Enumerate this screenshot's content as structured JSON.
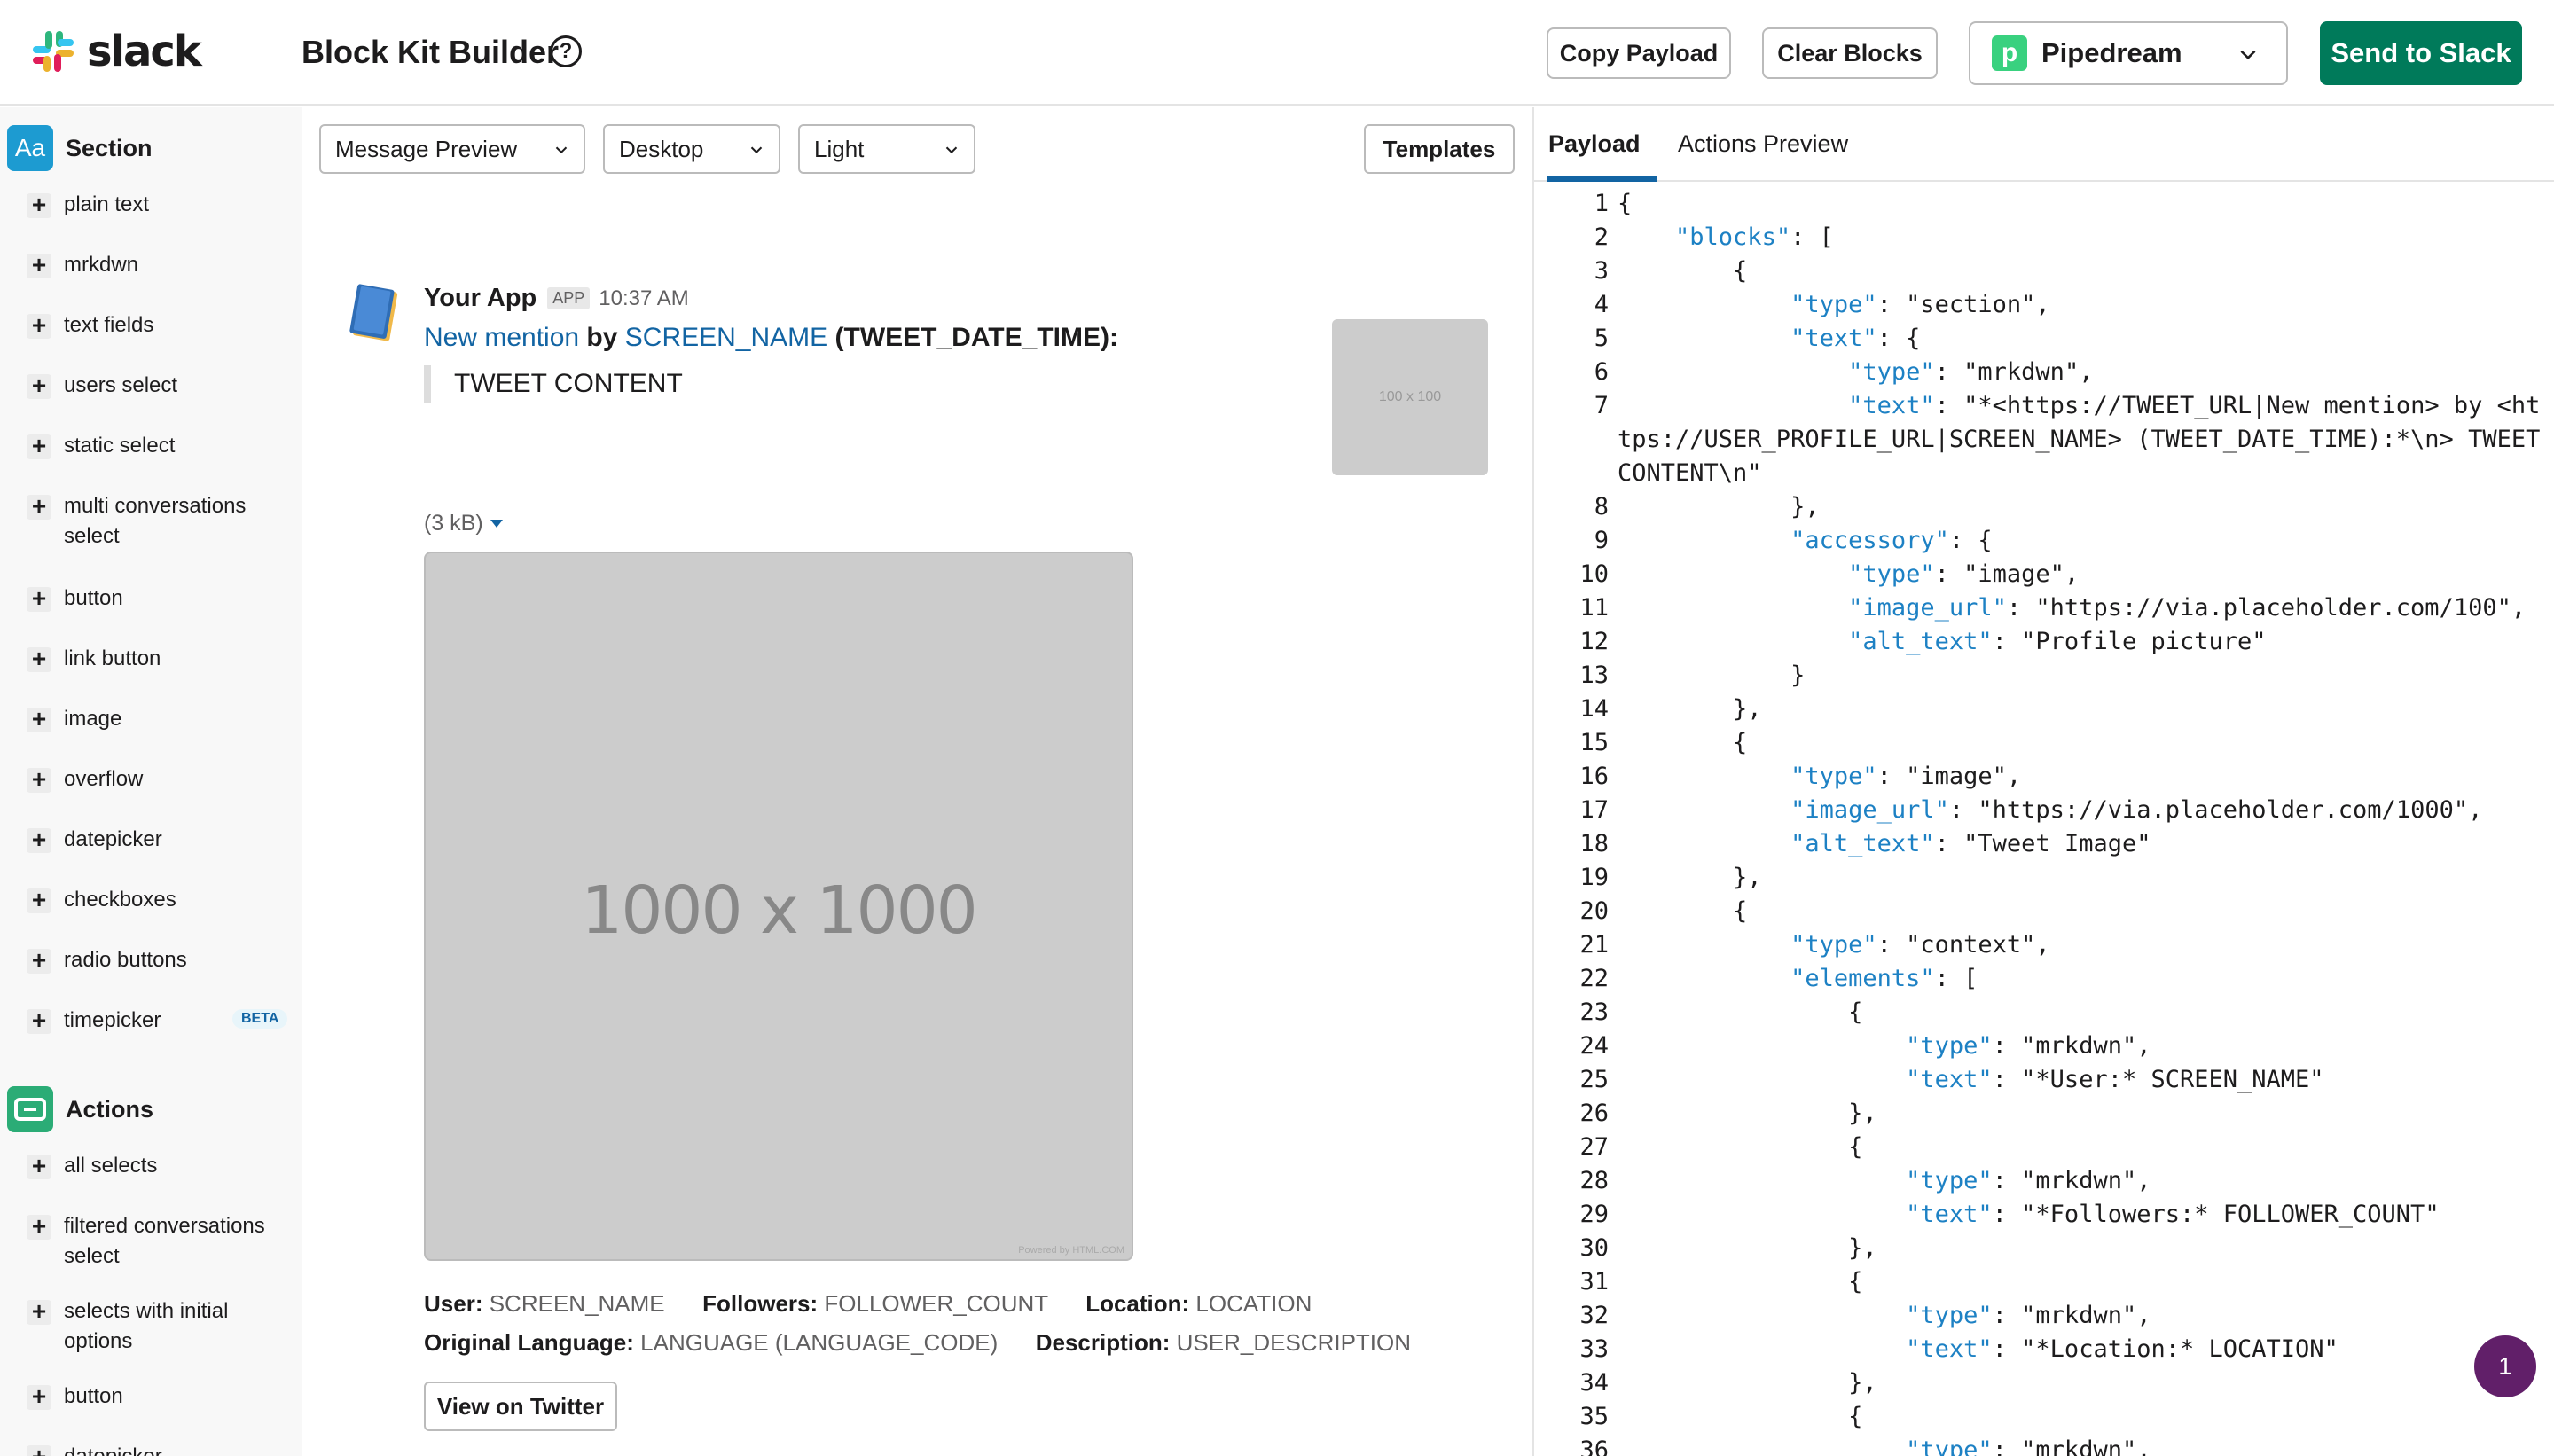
{
  "header": {
    "logo_text": "slack",
    "title": "Block Kit Builder",
    "help_icon": "?",
    "copy_label": "Copy Payload",
    "clear_label": "Clear Blocks",
    "integration": "Pipedream",
    "integration_icon": "p",
    "send_label": "Send to Slack"
  },
  "sidebar": {
    "sections": [
      {
        "label": "Section",
        "icon_text": "Aa"
      },
      {
        "label": "Actions",
        "icon_text": ""
      }
    ],
    "section_items": [
      "plain text",
      "mrkdwn",
      "text fields",
      "users select",
      "static select",
      "multi conversations select",
      "button",
      "link button",
      "image",
      "overflow",
      "datepicker",
      "checkboxes",
      "radio buttons",
      "timepicker"
    ],
    "beta_label": "BETA",
    "action_items": [
      "all selects",
      "filtered conversations select",
      "selects with initial options",
      "button",
      "datepicker"
    ]
  },
  "toolbar": {
    "view": "Message Preview",
    "device": "Desktop",
    "theme": "Light",
    "templates_label": "Templates"
  },
  "message": {
    "app_name": "Your App",
    "app_badge": "APP",
    "time": "10:37 AM",
    "link1": "New mention",
    "by": "by",
    "link2": "SCREEN_NAME",
    "date": "(TWEET_DATE_TIME):",
    "quote": "TWEET CONTENT",
    "thumb_text": "100 x 100",
    "image_size": "(3 kB)",
    "image_text": "1000 x 1000",
    "image_credit": "Powered by HTML.COM",
    "ctx1": [
      {
        "label": "User:",
        "value": "SCREEN_NAME"
      },
      {
        "label": "Followers:",
        "value": "FOLLOWER_COUNT"
      },
      {
        "label": "Location:",
        "value": "LOCATION"
      }
    ],
    "ctx2": [
      {
        "label": "Original Language:",
        "value": "LANGUAGE (LANGUAGE_CODE)"
      },
      {
        "label": "Description:",
        "value": "USER_DESCRIPTION"
      }
    ],
    "button_label": "View on Twitter"
  },
  "right_panel": {
    "tabs": [
      "Payload",
      "Actions Preview"
    ],
    "lines": [
      "{",
      "    \"blocks\": [",
      "        {",
      "            \"type\": \"section\",",
      "            \"text\": {",
      "                \"type\": \"mrkdwn\",",
      "                \"text\": \"*<https://TWEET_URL|New mention> by <https://USER_PROFILE_URL|SCREEN_NAME> (TWEET_DATE_TIME):*\\n> TWEET CONTENT\\n\"",
      "            },",
      "            \"accessory\": {",
      "                \"type\": \"image\",",
      "                \"image_url\": \"https://via.placeholder.com/100\",",
      "                \"alt_text\": \"Profile picture\"",
      "            }",
      "        },",
      "        {",
      "            \"type\": \"image\",",
      "            \"image_url\": \"https://via.placeholder.com/1000\",",
      "            \"alt_text\": \"Tweet Image\"",
      "        },",
      "        {",
      "            \"type\": \"context\",",
      "            \"elements\": [",
      "                {",
      "                    \"type\": \"mrkdwn\",",
      "                    \"text\": \"*User:* SCREEN_NAME\"",
      "                },",
      "                {",
      "                    \"type\": \"mrkdwn\",",
      "                    \"text\": \"*Followers:* FOLLOWER_COUNT\"",
      "                },",
      "                {",
      "                    \"type\": \"mrkdwn\",",
      "                    \"text\": \"*Location:* LOCATION\"",
      "                },",
      "                {",
      "                    \"type\": \"mrkdwn\","
    ]
  },
  "notification_count": "1"
}
